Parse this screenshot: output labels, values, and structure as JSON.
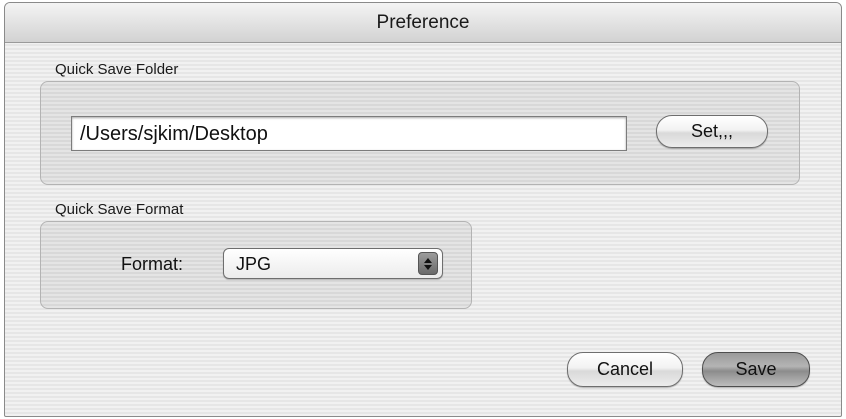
{
  "dialog": {
    "title": "Preference"
  },
  "quick_save_folder": {
    "label": "Quick Save Folder",
    "path_value": "/Users/sjkim/Desktop",
    "set_button": "Set,,,"
  },
  "quick_save_format": {
    "label": "Quick Save Format",
    "format_label": "Format:",
    "format_selected": "JPG",
    "format_options": [
      "JPG"
    ]
  },
  "actions": {
    "cancel_label": "Cancel",
    "save_label": "Save"
  },
  "icons": {
    "select_arrows": "up-down-arrows-icon"
  }
}
